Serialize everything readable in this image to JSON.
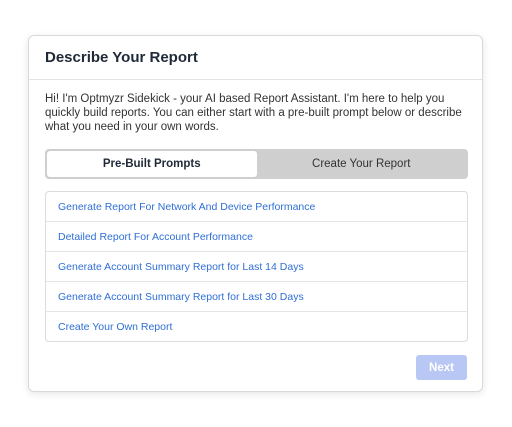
{
  "dialog": {
    "title": "Describe Your Report",
    "intro": "Hi! I'm Optmyzr Sidekick - your AI based Report Assistant. I'm here to help you quickly build reports. You can either start with a pre-built prompt below or describe what you need in your own words."
  },
  "tabs": [
    {
      "label": "Pre-Built Prompts",
      "active": true
    },
    {
      "label": "Create Your Report",
      "active": false
    }
  ],
  "prompts": [
    {
      "label": "Generate Report For Network And Device Performance"
    },
    {
      "label": "Detailed Report For Account Performance"
    },
    {
      "label": "Generate Account Summary Report for Last 14 Days"
    },
    {
      "label": "Generate Account Summary Report for Last 30 Days"
    },
    {
      "label": "Create Your Own Report"
    }
  ],
  "footer": {
    "next_label": "Next"
  },
  "colors": {
    "link": "#2f6fd6",
    "toggle_track": "#cfcfcf",
    "next_button_disabled": "#b9c7f5"
  }
}
